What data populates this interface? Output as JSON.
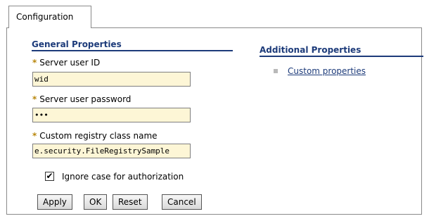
{
  "tab": {
    "label": "Configuration"
  },
  "general": {
    "title": "General Properties",
    "fields": [
      {
        "label": "Server user ID",
        "value": "wid"
      },
      {
        "label": "Server user password",
        "value": "•••"
      },
      {
        "label": "Custom registry class name",
        "value": "e.security.FileRegistrySample"
      }
    ],
    "checkbox": {
      "label": "Ignore case for authorization",
      "checked": true,
      "mark": "✔"
    }
  },
  "additional": {
    "title": "Additional Properties",
    "links": [
      {
        "label": "Custom properties"
      }
    ]
  },
  "buttons": {
    "apply": "Apply",
    "ok": "OK",
    "reset": "Reset",
    "cancel": "Cancel"
  },
  "colors": {
    "heading": "#1d3b7a",
    "input_bg": "#fdf6d6",
    "required_marker": "#b8860b"
  },
  "required_marker": "*"
}
